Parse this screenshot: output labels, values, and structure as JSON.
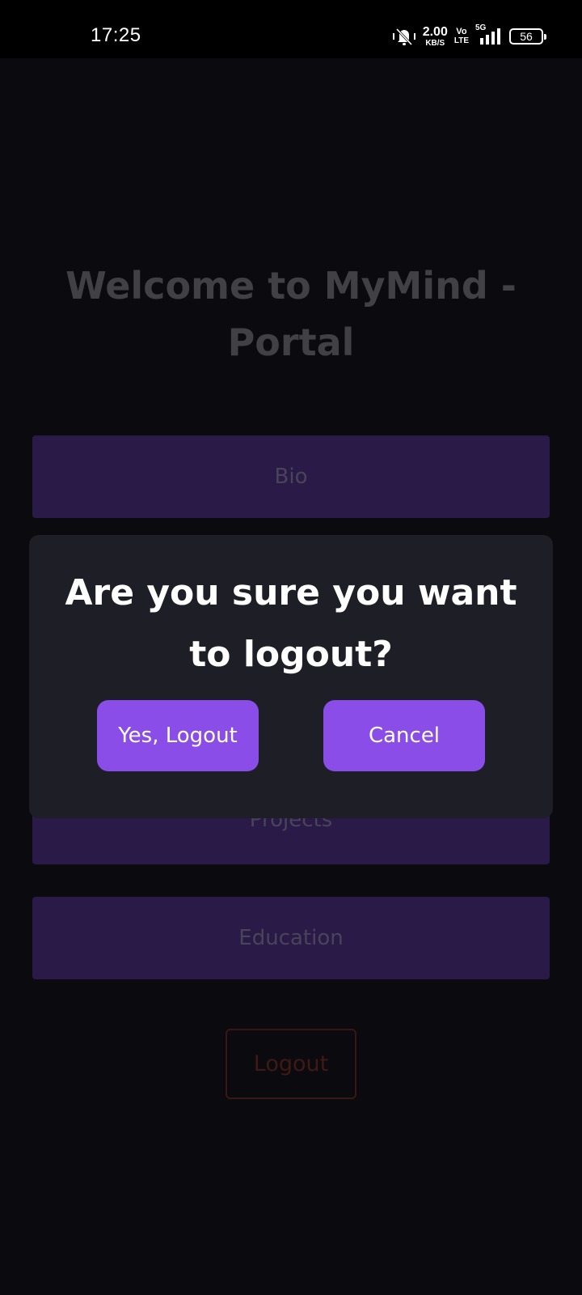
{
  "status_bar": {
    "time": "17:25",
    "net_speed_value": "2.00",
    "net_speed_unit": "KB/S",
    "volte_top": "Vo",
    "volte_bottom": "LTE",
    "network_type": "5G",
    "battery": "56",
    "icons": [
      "mute-bell-icon",
      "signal-icon",
      "battery-icon"
    ]
  },
  "page": {
    "title": "Welcome to MyMind - Portal",
    "nav_items": [
      {
        "label": "Bio"
      },
      {
        "label": "Projects"
      },
      {
        "label": "Education"
      }
    ],
    "logout_label": "Logout"
  },
  "dialog": {
    "message": "Are you sure you want to logout?",
    "confirm_label": "Yes, Logout",
    "cancel_label": "Cancel"
  },
  "colors": {
    "background": "#0b0a0e",
    "nav_button": "#2a1a48",
    "dialog_bg": "#1e1e26",
    "dialog_button": "#8a4de8",
    "logout_border": "#3a1614"
  }
}
